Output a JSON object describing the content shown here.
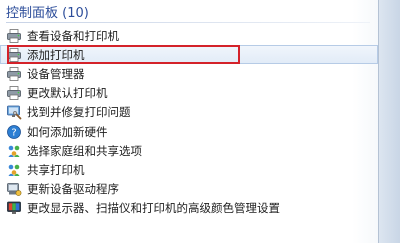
{
  "header": {
    "title": "控制面板 (10)"
  },
  "items": [
    {
      "label": "查看设备和打印机",
      "icon": "printer-icon"
    },
    {
      "label": "添加打印机",
      "icon": "printer-icon"
    },
    {
      "label": "设备管理器",
      "icon": "printer-icon"
    },
    {
      "label": "更改默认打印机",
      "icon": "printer-icon"
    },
    {
      "label": "找到并修复打印问题",
      "icon": "troubleshoot-icon"
    },
    {
      "label": "如何添加新硬件",
      "icon": "help-icon"
    },
    {
      "label": "选择家庭组和共享选项",
      "icon": "homegroup-icon"
    },
    {
      "label": "共享打印机",
      "icon": "homegroup-icon"
    },
    {
      "label": "更新设备驱动程序",
      "icon": "device-manager-icon"
    },
    {
      "label": "更改显示器、扫描仪和打印机的高级颜色管理设置",
      "icon": "color-management-icon"
    }
  ],
  "colors": {
    "header": "#2c4d9a",
    "highlight_border": "#d4222a"
  }
}
